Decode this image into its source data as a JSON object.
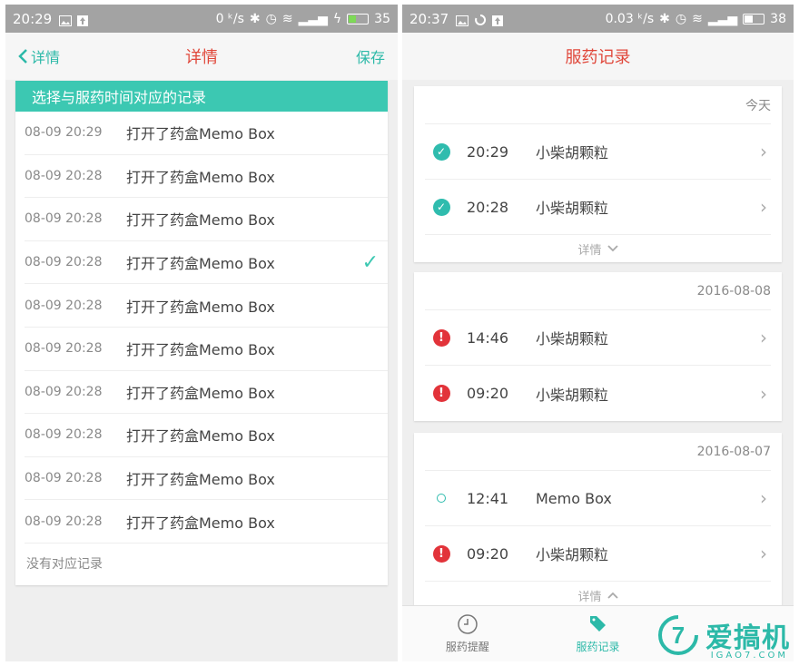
{
  "left_screen": {
    "status": {
      "time": "20:29",
      "net": "0 ᵏ/s",
      "battery": "35"
    },
    "nav": {
      "back_label": "详情",
      "title": "详情",
      "save_label": "保存"
    },
    "list_header": "选择与服药时间对应的记录",
    "records": [
      {
        "time": "08-09 20:29",
        "action": "打开了药盒Memo Box",
        "selected": false
      },
      {
        "time": "08-09 20:28",
        "action": "打开了药盒Memo Box",
        "selected": false
      },
      {
        "time": "08-09 20:28",
        "action": "打开了药盒Memo Box",
        "selected": false
      },
      {
        "time": "08-09 20:28",
        "action": "打开了药盒Memo Box",
        "selected": true
      },
      {
        "time": "08-09 20:28",
        "action": "打开了药盒Memo Box",
        "selected": false
      },
      {
        "time": "08-09 20:28",
        "action": "打开了药盒Memo Box",
        "selected": false
      },
      {
        "time": "08-09 20:28",
        "action": "打开了药盒Memo Box",
        "selected": false
      },
      {
        "time": "08-09 20:28",
        "action": "打开了药盒Memo Box",
        "selected": false
      },
      {
        "time": "08-09 20:28",
        "action": "打开了药盒Memo Box",
        "selected": false
      },
      {
        "time": "08-09 20:28",
        "action": "打开了药盒Memo Box",
        "selected": false
      }
    ],
    "no_record_label": "没有对应记录"
  },
  "right_screen": {
    "status": {
      "time": "20:37",
      "net": "0.03 ᵏ/s",
      "battery": "38"
    },
    "nav": {
      "title": "服药记录"
    },
    "groups": [
      {
        "date": "今天",
        "entries": [
          {
            "status": "taken",
            "time": "20:29",
            "name": "小柴胡颗粒"
          },
          {
            "status": "taken",
            "time": "20:28",
            "name": "小柴胡颗粒"
          }
        ],
        "toggle": {
          "label": "详情",
          "chevron": "chevron-down-icon"
        }
      },
      {
        "date": "2016-08-08",
        "entries": [
          {
            "status": "missed",
            "time": "14:46",
            "name": "小柴胡颗粒"
          },
          {
            "status": "missed",
            "time": "09:20",
            "name": "小柴胡颗粒"
          }
        ]
      },
      {
        "date": "2016-08-07",
        "entries": [
          {
            "status": "opened",
            "time": "12:41",
            "name": "Memo Box"
          },
          {
            "status": "missed",
            "time": "09:20",
            "name": "小柴胡颗粒"
          }
        ],
        "toggle": {
          "label": "详情",
          "chevron": "chevron-up-icon"
        }
      }
    ],
    "tabs": [
      {
        "label": "服药提醒",
        "icon": "clock-icon",
        "active": false
      },
      {
        "label": "服药记录",
        "icon": "pill-tag-icon",
        "active": true
      },
      {
        "label": "",
        "icon": "",
        "active": false
      }
    ]
  },
  "watermark": {
    "brand": "爱搞机",
    "sub": "IGAO7.COM",
    "logo_char": "7"
  },
  "colors": {
    "accent": "#2cb9a8",
    "title_red": "#e0473a",
    "warn": "#e2333a",
    "header_teal": "#3cc8b2"
  }
}
